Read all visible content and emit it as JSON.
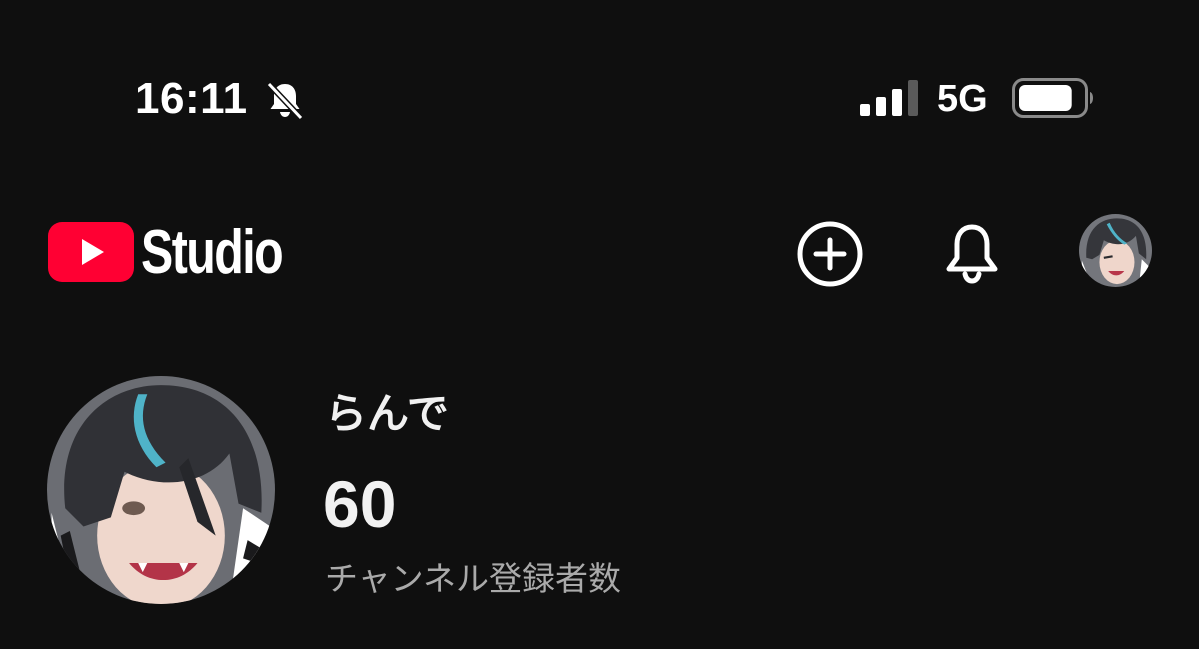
{
  "status_bar": {
    "time": "16:11",
    "silent_icon": "bell-slash-icon",
    "signal_icon": "cellular-signal-icon",
    "signal_bars": 3,
    "signal_bars_total": 4,
    "network": "5G",
    "battery_icon": "battery-icon",
    "battery_level": 0.85
  },
  "header": {
    "logo_icon": "youtube-play-icon",
    "logo_text": "Studio",
    "create_icon": "plus-circle-icon",
    "notifications_icon": "bell-icon",
    "account_avatar": "avatar"
  },
  "channel": {
    "name": "らんで",
    "subscriber_count": "60",
    "subscriber_label": "チャンネル登録者数"
  },
  "colors": {
    "background": "#0f0f0f",
    "text": "#f1f1f1",
    "secondary_text": "#aaaaaa",
    "youtube_red": "#ff0033"
  }
}
